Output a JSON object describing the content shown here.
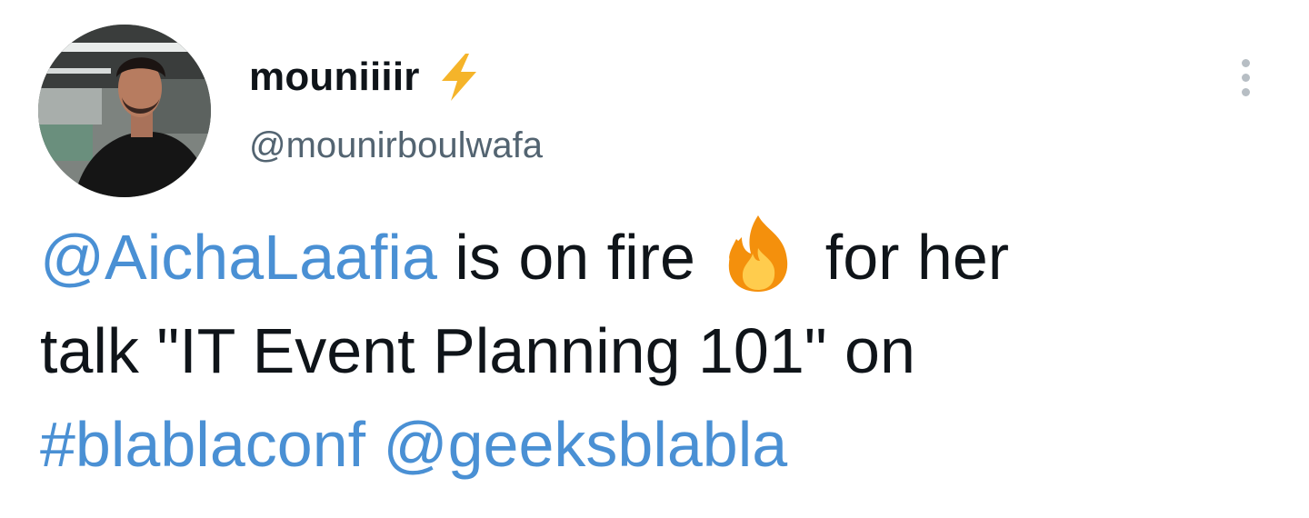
{
  "tweet": {
    "author": {
      "display_name": "mouniiiir",
      "handle": "@mounirboulwafa",
      "badge_icon": "lightning-bolt-icon",
      "avatar_icon": "profile-photo"
    },
    "more_icon": "more-vertical-icon",
    "text": {
      "mention_1": "@AichaLaafia",
      "part_1": " is on fire ",
      "emoji_icon": "fire-emoji-icon",
      "part_2": " for her",
      "line_2": "talk \"IT Event Planning 101\" on",
      "hashtag": "#blablaconf",
      "mention_2": "@geeksblabla"
    }
  },
  "colors": {
    "link": "#4a90d4",
    "text": "#0f1419",
    "secondary": "#536471",
    "bolt": "#f5b42a"
  }
}
